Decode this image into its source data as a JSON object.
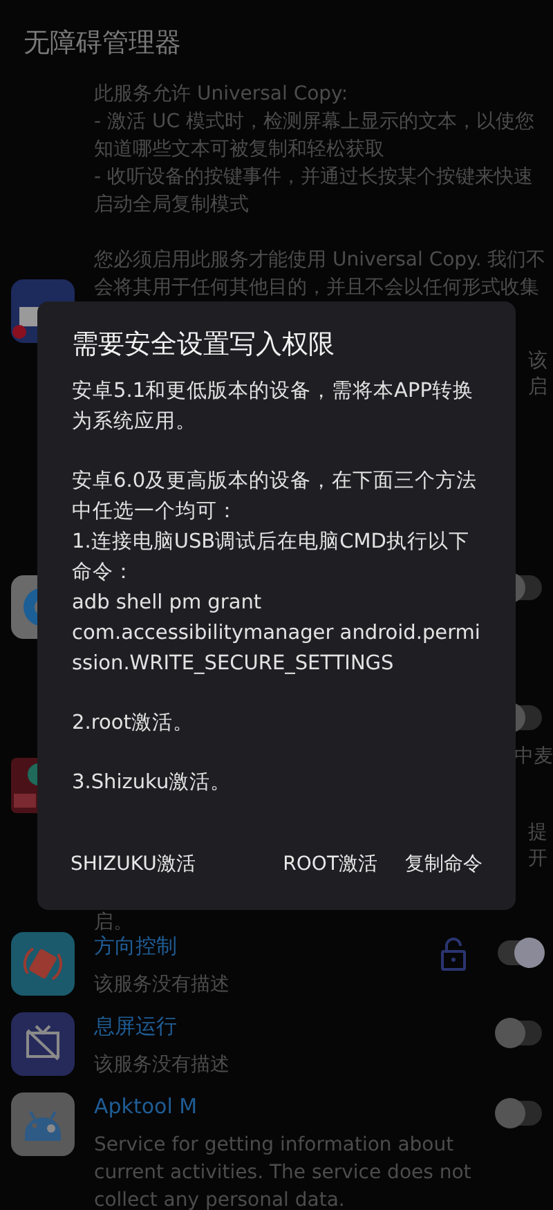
{
  "app_title": "无障碍管理器",
  "intro": {
    "paragraphs": [
      "此服务允许 Universal Copy:\n- 激活 UC 模式时，检测屏幕上显示的文本，以使您知道哪些文本可被复制和轻松获取\n- 收听设备的按键事件，并通过长按某个按键来快速启动全局复制模式",
      "您必须启用此服务才能使用 Universal Copy. 我们不会将其用于任何其他目的，并且不会以任何形式收集"
    ]
  },
  "covered": {
    "fragments_top": [
      "该",
      "启"
    ],
    "toggles": [
      {
        "on": false
      },
      {
        "on": false
      }
    ],
    "fragment_middle": "中麦",
    "fragments_lower": [
      "提",
      "开"
    ],
    "fragment_left": "启。"
  },
  "services": [
    {
      "kind": "rotate",
      "title": "方向控制",
      "description": "该服务没有描述",
      "lock": true,
      "on": true
    },
    {
      "kind": "screen_off",
      "title": "息屏运行",
      "description": "该服务没有描述",
      "on": false
    },
    {
      "kind": "android",
      "title": "Apktool M",
      "description": "Service for getting information about current activities. The service does not collect any personal data.",
      "on": false
    }
  ],
  "dialog": {
    "title": "需要安全设置写入权限",
    "paragraphs": [
      "安卓5.1和更低版本的设备，需将本APP转换为系统应用。",
      "安卓6.0及更高版本的设备，在下面三个方法中任选一个均可：\n1.连接电脑USB调试后在电脑CMD执行以下命令：\nadb shell pm grant\ncom.accessibilitymanager android.permission.WRITE_SECURE_SETTINGS",
      "2.root激活。",
      "3.Shizuku激活。"
    ],
    "buttons": [
      "SHIZUKU激活",
      "ROOT激活",
      "复制命令"
    ]
  }
}
